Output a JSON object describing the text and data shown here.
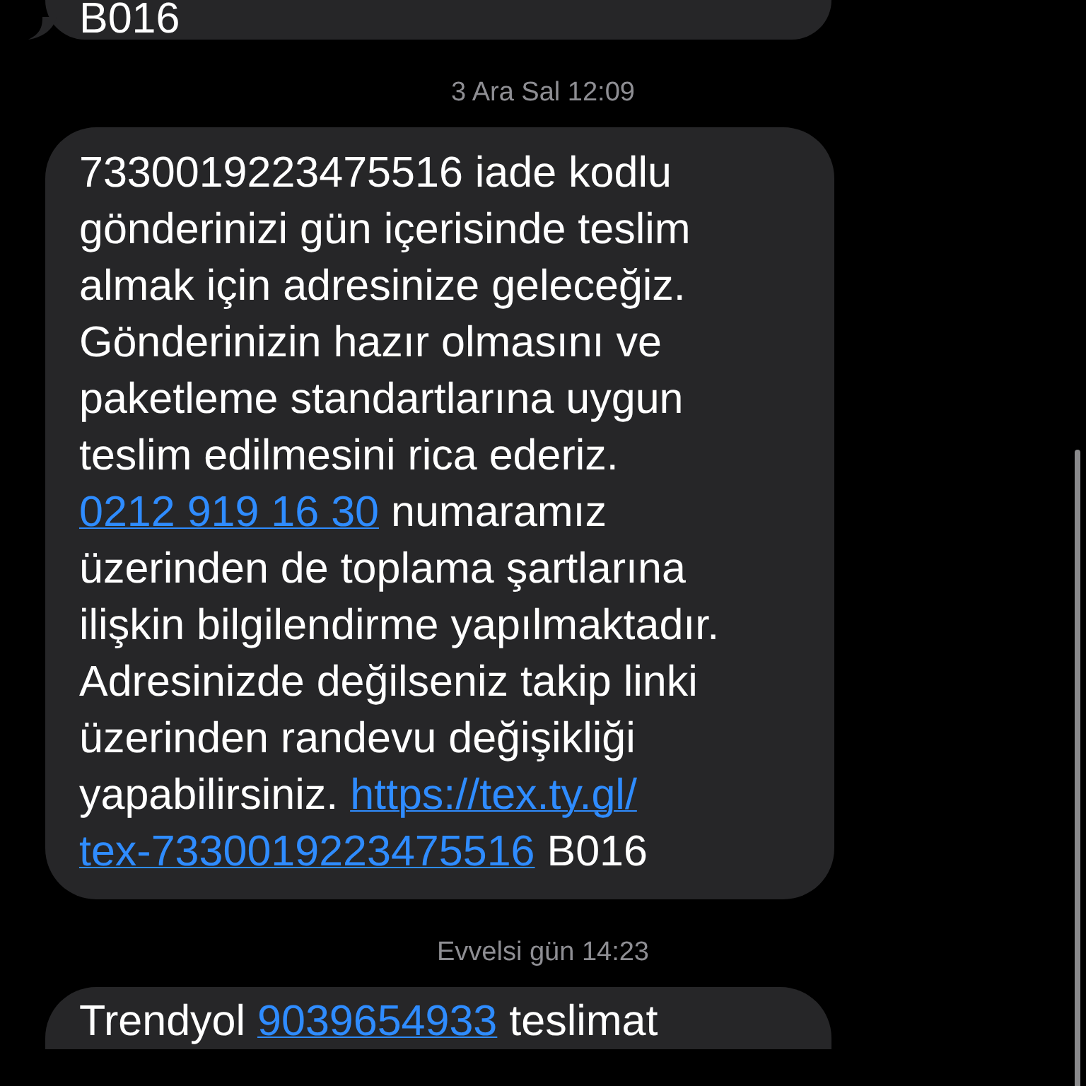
{
  "messages": [
    {
      "kind": "bubble",
      "parts": [
        {
          "kind": "text",
          "text": "B016"
        }
      ]
    },
    {
      "kind": "timestamp",
      "text": "3 Ara Sal 12:09"
    },
    {
      "kind": "bubble",
      "parts": [
        {
          "kind": "text",
          "text": "7330019223475516 iade kodlu gönderinizi gün içerisinde teslim almak için adresinize geleceğiz. Gönderinizin hazır olmasını ve paketleme standartlarına uygun teslim edilmesini rica ederiz. "
        },
        {
          "kind": "link",
          "text": "0212 919 16 30"
        },
        {
          "kind": "text",
          "text": " numaramız üzerinden de toplama şartlarına ilişkin bilgilendirme yapılmaktadır. Adresinizde değilseniz takip linki üzerinden randevu değişikliği yapabilirsiniz. "
        },
        {
          "kind": "link",
          "text": "https://tex.ty.gl/"
        },
        {
          "kind": "link",
          "text": "tex-7330019223475516"
        },
        {
          "kind": "text",
          "text": " B016"
        }
      ]
    },
    {
      "kind": "timestamp",
      "text": "Evvelsi gün 14:23"
    },
    {
      "kind": "bubble",
      "parts": [
        {
          "kind": "text",
          "text": "Trendyol "
        },
        {
          "kind": "link",
          "text": "9039654933"
        },
        {
          "kind": "text",
          "text": " teslimat"
        }
      ]
    }
  ]
}
